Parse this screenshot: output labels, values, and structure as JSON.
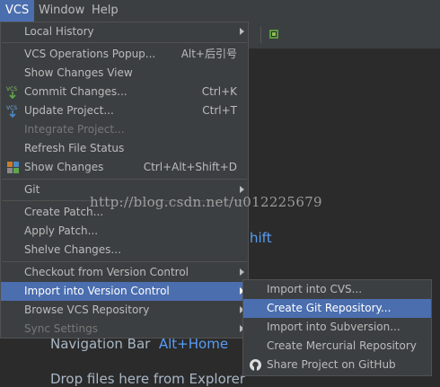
{
  "menubar": {
    "items": [
      {
        "label": "VCS",
        "active": true
      },
      {
        "label": "Window",
        "active": false
      },
      {
        "label": "Help",
        "active": false
      }
    ]
  },
  "editor_hints": {
    "shift_text": "hift",
    "navigation_bar": "Navigation Bar",
    "navigation_shortcut": "Alt+Home",
    "drop_files": "Drop files here from Explorer"
  },
  "watermark": "http://blog.csdn.net/u012225679",
  "vcs_menu": {
    "items": [
      {
        "label": "Local History",
        "submenu": true
      },
      {
        "label": "VCS Operations Popup...",
        "shortcut": "Alt+后引号"
      },
      {
        "label": "Show Changes View"
      },
      {
        "label": "Commit Changes...",
        "shortcut": "Ctrl+K",
        "icon": "vcs-commit-icon"
      },
      {
        "label": "Update Project...",
        "shortcut": "Ctrl+T",
        "icon": "vcs-update-icon"
      },
      {
        "label": "Integrate Project...",
        "disabled": true
      },
      {
        "label": "Refresh File Status"
      },
      {
        "label": "Show Changes",
        "shortcut": "Ctrl+Alt+Shift+D",
        "icon": "show-changes-icon"
      },
      {
        "label": "Git",
        "submenu": true
      },
      {
        "label": "Create Patch..."
      },
      {
        "label": "Apply Patch..."
      },
      {
        "label": "Shelve Changes..."
      },
      {
        "label": "Checkout from Version Control",
        "submenu": true
      },
      {
        "label": "Import into Version Control",
        "submenu": true,
        "selected": true
      },
      {
        "label": "Browse VCS Repository",
        "submenu": true
      },
      {
        "label": "Sync Settings",
        "submenu": true,
        "disabled": true
      }
    ]
  },
  "import_submenu": {
    "items": [
      {
        "label": "Import into CVS..."
      },
      {
        "label": "Create Git Repository...",
        "selected": true
      },
      {
        "label": "Import into Subversion..."
      },
      {
        "label": "Create Mercurial Repository"
      },
      {
        "label": "Share Project on GitHub",
        "icon": "github-icon"
      }
    ]
  },
  "colors": {
    "menu_bg": "#3c3f41",
    "selection": "#4b6eaf",
    "editor_bg": "#2b2b2b",
    "shortcut_blue": "#589df6"
  }
}
